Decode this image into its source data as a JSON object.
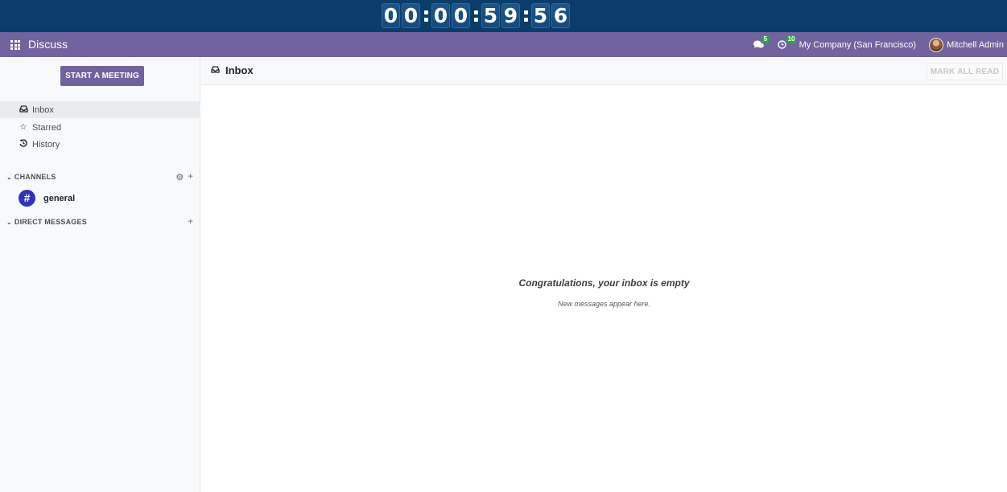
{
  "timer": {
    "digits": [
      "0",
      "0",
      "0",
      "0",
      "5",
      "9",
      "5",
      "6"
    ]
  },
  "navbar": {
    "app_name": "Discuss",
    "messages_count": "5",
    "activities_count": "10",
    "company": "My Company (San Francisco)",
    "user": "Mitchell Admin"
  },
  "sidebar": {
    "start_meeting": "START A MEETING",
    "mailboxes": [
      {
        "label": "Inbox",
        "icon": "inbox-icon"
      },
      {
        "label": "Starred",
        "icon": "star-icon"
      },
      {
        "label": "History",
        "icon": "history-icon"
      }
    ],
    "channels_header": "CHANNELS",
    "channels": [
      {
        "name": "general"
      }
    ],
    "dm_header": "DIRECT MESSAGES"
  },
  "main": {
    "title": "Inbox",
    "mark_all_read": "MARK ALL READ",
    "empty_title": "Congratulations, your inbox is empty",
    "empty_subtitle": "New messages appear here."
  },
  "colors": {
    "navbar": "#71639e",
    "timer_bg": "#0b3d6b",
    "badge": "#28a745",
    "channel_avatar": "#3034b4"
  }
}
